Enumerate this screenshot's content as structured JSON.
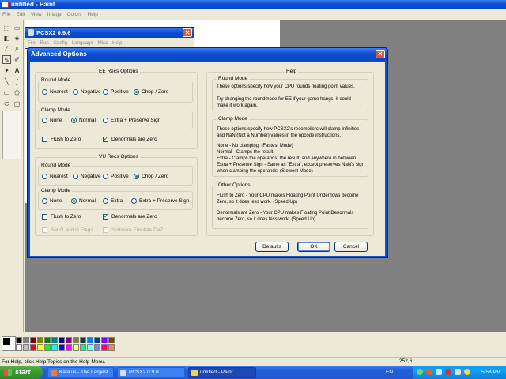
{
  "paint": {
    "title": "untitled - Paint",
    "menu": [
      "File",
      "Edit",
      "View",
      "Image",
      "Colors",
      "Help"
    ],
    "status_text": "For Help, click Help Topics on the Help Menu.",
    "status_coords": "252,6"
  },
  "pcsx2": {
    "title": "PCSX2 0.9.6",
    "menu": [
      "File",
      "Run",
      "Config",
      "Language",
      "Misc",
      "Help"
    ]
  },
  "dialog": {
    "title": "Advanced Options",
    "ee": {
      "title": "EE Recs Options",
      "round_mode": {
        "label": "Round Mode",
        "options": [
          "Nearest",
          "Negative",
          "Positive",
          "Chop / Zero"
        ],
        "selected": "Chop / Zero"
      },
      "clamp_mode": {
        "label": "Clamp Mode",
        "options": [
          "None",
          "Normal",
          "Extra + Preserve Sign"
        ],
        "selected": "Normal"
      },
      "flush_to_zero": {
        "label": "Flush to Zero",
        "checked": false
      },
      "denormals_are_zero": {
        "label": "Denormals are Zero",
        "checked": true
      }
    },
    "vu": {
      "title": "VU Recs Options",
      "round_mode": {
        "label": "Round Mode",
        "options": [
          "Nearest",
          "Negative",
          "Positive",
          "Chop / Zero"
        ],
        "selected": "Chop / Zero"
      },
      "clamp_mode": {
        "label": "Clamp Mode",
        "options": [
          "None",
          "Normal",
          "Extra",
          "Extra + Preserve Sign"
        ],
        "selected": "Normal"
      },
      "flush_to_zero": {
        "label": "Flush to Zero",
        "checked": false
      },
      "denormals_are_zero": {
        "label": "Denormals are Zero",
        "checked": true
      },
      "set_o_u_flags": {
        "label": "Set O and U Flags",
        "checked": false,
        "enabled": false
      },
      "software_emulate_daz": {
        "label": "Software Emulate DaZ",
        "checked": false,
        "enabled": false
      }
    },
    "help": {
      "title": "Help",
      "round_mode": {
        "label": "Round Mode",
        "lines": [
          "These options specify how your CPU rounds floating point values.",
          "",
          "Try changing the roundmode for EE if your game hangs, it could",
          "make it work again."
        ]
      },
      "clamp_mode": {
        "label": "Clamp Mode",
        "lines": [
          "These options specify how PCSX2's recompilers will clamp Infinities",
          "and NaN (Not a Number) values in the opcode instructions.",
          "",
          "None - No clamping. (Fastest Mode)",
          "Normal - Clamps the result.",
          "Extra - Clamps the operands, the result, and anywhere in between.",
          "Extra + Preserve Sign - Same as \"Extra\", except preserves NaN's sign",
          "when clamping the operands. (Slowest Mode)"
        ]
      },
      "other": {
        "label": "Other Options",
        "lines": [
          "Flush to Zero - Your CPU makes Floating Point Underflows become",
          "Zero, so it does less work. (Speed Up)",
          "",
          "Denormals are Zero - Your CPU makes Floating Point Denormals",
          "become Zero, so it does less work. (Speed Up)"
        ]
      }
    },
    "buttons": {
      "defaults": "Defaults",
      "ok": "OK",
      "cancel": "Cancel"
    }
  },
  "taskbar": {
    "start": "start",
    "items": [
      "Kaskus - The Largest ...",
      "PCSX2 0.9.6",
      "untitled - Paint"
    ],
    "lang": "EN",
    "clock": "5:53 PM"
  },
  "palette": [
    "#000000",
    "#808080",
    "#800000",
    "#808000",
    "#008000",
    "#008080",
    "#000080",
    "#800080",
    "#808040",
    "#004040",
    "#0080ff",
    "#004080",
    "#8000ff",
    "#804000",
    "#ffffff",
    "#c0c0c0",
    "#ff0000",
    "#ffff00",
    "#00ff00",
    "#00ffff",
    "#0000ff",
    "#ff00ff",
    "#ffff80",
    "#00ff80",
    "#80ffff",
    "#8080ff",
    "#ff0080",
    "#ff8040"
  ]
}
